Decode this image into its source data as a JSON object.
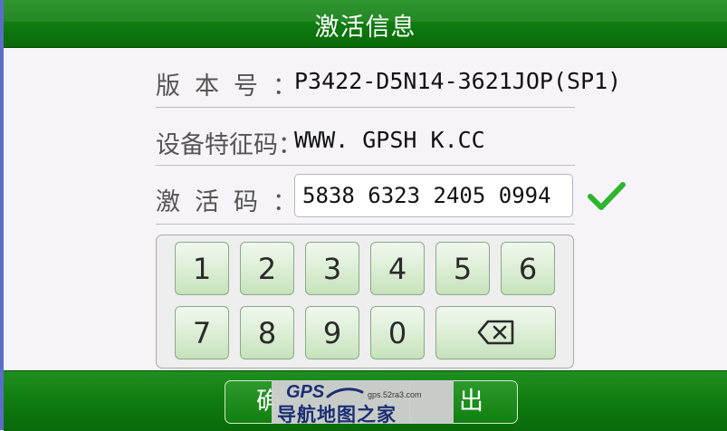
{
  "title": "激活信息",
  "version": {
    "label": "版本号：",
    "value": "P3422-D5N14-3621JOP(SP1)"
  },
  "device": {
    "label": "设备特征码：",
    "value": "WWW. GPSH K.CC"
  },
  "activation": {
    "label": "激活码：",
    "value": "5838 6323 2405 0994",
    "status_icon": "check-icon"
  },
  "keypad": {
    "row1": [
      "1",
      "2",
      "3",
      "4",
      "5",
      "6"
    ],
    "row2": [
      "7",
      "8",
      "9",
      "0"
    ],
    "backspace_icon": "backspace-icon"
  },
  "buttons": {
    "confirm_visible": "确",
    "exit_visible": "出"
  },
  "watermark": {
    "logo": "GPS",
    "url": "gps.52ra3.com",
    "name": "导航地图之家"
  },
  "colors": {
    "header_green": "#0f7a0f",
    "check_green": "#2db52d",
    "key_green": "#cde6c3"
  }
}
